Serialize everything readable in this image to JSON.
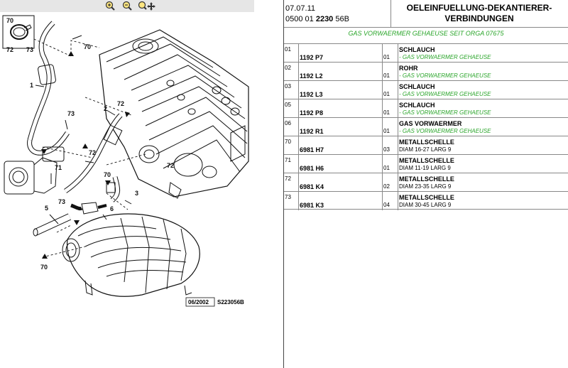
{
  "toolbar": {
    "zoom_in_icon": "zoom-in-icon",
    "zoom_out_icon": "zoom-out-icon",
    "zoom_move_icon": "zoom-pan-icon"
  },
  "header": {
    "date": "07.07.11",
    "ref_prefix": "0500 01",
    "ref_bold": "2230",
    "ref_suffix": "56B",
    "title_line1": "OELEINFUELLUNG-DEKANTIERER-",
    "title_line2": "VERBINDUNGEN",
    "subtitle": "GAS VORWAERMER GEHAEUSE SEIT ORGA 07675"
  },
  "parts": [
    {
      "no": "01",
      "part": "1192 P7",
      "qty": "01",
      "name": "SCHLAUCH",
      "desc": "- GAS VORWAERMER GEHAEUSE",
      "green": true
    },
    {
      "no": "02",
      "part": "1192 L2",
      "qty": "01",
      "name": "ROHR",
      "desc": "- GAS VORWAERMER GEHAEUSE",
      "green": true
    },
    {
      "no": "03",
      "part": "1192 L3",
      "qty": "01",
      "name": "SCHLAUCH",
      "desc": "- GAS VORWAERMER GEHAEUSE",
      "green": true
    },
    {
      "no": "05",
      "part": "1192 P8",
      "qty": "01",
      "name": "SCHLAUCH",
      "desc": "- GAS VORWAERMER GEHAEUSE",
      "green": true
    },
    {
      "no": "06",
      "part": "1192 R1",
      "qty": "01",
      "name": "GAS VORWAERMER",
      "desc": "- GAS VORWAERMER GEHAEUSE",
      "green": true
    },
    {
      "no": "70",
      "part": "6981 H7",
      "qty": "03",
      "name": "METALLSCHELLE",
      "desc": "DIAM 16-27 LARG 9",
      "green": false
    },
    {
      "no": "71",
      "part": "6981 H6",
      "qty": "01",
      "name": "METALLSCHELLE",
      "desc": "DIAM 11-19 LARG 9",
      "green": false
    },
    {
      "no": "72",
      "part": "6981 K4",
      "qty": "02",
      "name": "METALLSCHELLE",
      "desc": "DIAM 23-35 LARG 9",
      "green": false
    },
    {
      "no": "73",
      "part": "6981 K3",
      "qty": "04",
      "name": "METALLSCHELLE",
      "desc": "DIAM 30-45 LARG 9",
      "green": false
    }
  ],
  "diagram": {
    "callouts": [
      "70",
      "72",
      "73",
      "1",
      "2",
      "72",
      "73",
      "72",
      "70",
      "71",
      "3",
      "5",
      "73",
      "6",
      "70",
      "70",
      "72"
    ],
    "date_stamp": "06/2002",
    "drawing_code": "S223056B"
  }
}
